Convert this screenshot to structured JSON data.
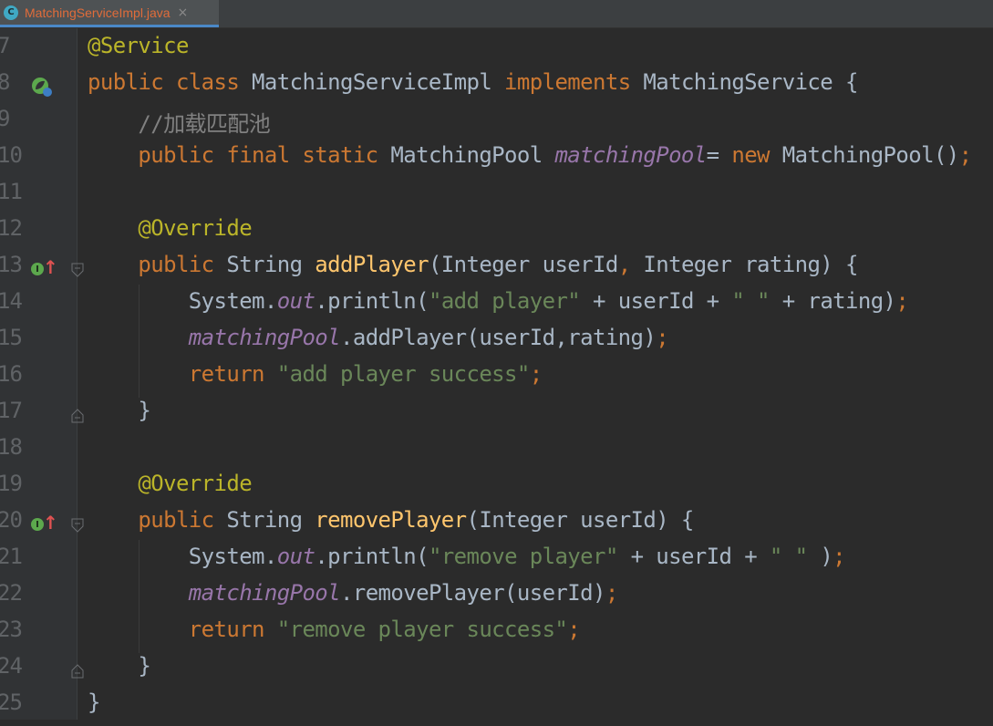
{
  "tab": {
    "icon": "class-c-icon",
    "label": "MatchingServiceImpl.java",
    "close": "×"
  },
  "lines": [
    {
      "num": "7",
      "tokens": [
        {
          "t": "@Service",
          "c": "ann"
        }
      ]
    },
    {
      "num": "8",
      "tokens": [
        {
          "t": "public class ",
          "c": "kw"
        },
        {
          "t": "MatchingServiceImpl ",
          "c": ""
        },
        {
          "t": "implements ",
          "c": "kw"
        },
        {
          "t": "MatchingService {",
          "c": ""
        }
      ]
    },
    {
      "num": "9",
      "tokens": [
        {
          "t": "    //加载匹配池",
          "c": "cmt"
        }
      ]
    },
    {
      "num": "10",
      "tokens": [
        {
          "t": "    public final static ",
          "c": "kw"
        },
        {
          "t": "MatchingPool ",
          "c": ""
        },
        {
          "t": "matchingPool",
          "c": "fld"
        },
        {
          "t": "= ",
          "c": ""
        },
        {
          "t": "new ",
          "c": "kw"
        },
        {
          "t": "MatchingPool()",
          "c": ""
        },
        {
          "t": ";",
          "c": "kw"
        }
      ]
    },
    {
      "num": "11",
      "tokens": []
    },
    {
      "num": "12",
      "tokens": [
        {
          "t": "    @Override",
          "c": "ann"
        }
      ]
    },
    {
      "num": "13",
      "tokens": [
        {
          "t": "    public ",
          "c": "kw"
        },
        {
          "t": "String ",
          "c": ""
        },
        {
          "t": "addPlayer",
          "c": "meth"
        },
        {
          "t": "(Integer userId",
          "c": ""
        },
        {
          "t": ", ",
          "c": "kw"
        },
        {
          "t": "Integer rating) {",
          "c": ""
        }
      ]
    },
    {
      "num": "14",
      "tokens": [
        {
          "t": "        System.",
          "c": ""
        },
        {
          "t": "out",
          "c": "fld"
        },
        {
          "t": ".println(",
          "c": ""
        },
        {
          "t": "\"add player\" ",
          "c": "str"
        },
        {
          "t": "+ userId + ",
          "c": ""
        },
        {
          "t": "\" \" ",
          "c": "str"
        },
        {
          "t": "+ rating)",
          "c": ""
        },
        {
          "t": ";",
          "c": "kw"
        }
      ]
    },
    {
      "num": "15",
      "tokens": [
        {
          "t": "        ",
          "c": ""
        },
        {
          "t": "matchingPool",
          "c": "fld"
        },
        {
          "t": ".addPlayer(userId,rating)",
          "c": ""
        },
        {
          "t": ";",
          "c": "kw"
        }
      ]
    },
    {
      "num": "16",
      "tokens": [
        {
          "t": "        return ",
          "c": "kw"
        },
        {
          "t": "\"add player success\"",
          "c": "str"
        },
        {
          "t": ";",
          "c": "kw"
        }
      ]
    },
    {
      "num": "17",
      "tokens": [
        {
          "t": "    }",
          "c": ""
        }
      ]
    },
    {
      "num": "18",
      "tokens": []
    },
    {
      "num": "19",
      "tokens": [
        {
          "t": "    @Override",
          "c": "ann"
        }
      ]
    },
    {
      "num": "20",
      "tokens": [
        {
          "t": "    public ",
          "c": "kw"
        },
        {
          "t": "String ",
          "c": ""
        },
        {
          "t": "removePlayer",
          "c": "meth"
        },
        {
          "t": "(Integer userId) {",
          "c": ""
        }
      ]
    },
    {
      "num": "21",
      "tokens": [
        {
          "t": "        System.",
          "c": ""
        },
        {
          "t": "out",
          "c": "fld"
        },
        {
          "t": ".println(",
          "c": ""
        },
        {
          "t": "\"remove player\" ",
          "c": "str"
        },
        {
          "t": "+ userId + ",
          "c": ""
        },
        {
          "t": "\" \" ",
          "c": "str"
        },
        {
          "t": ")",
          "c": ""
        },
        {
          "t": ";",
          "c": "kw"
        }
      ]
    },
    {
      "num": "22",
      "tokens": [
        {
          "t": "        ",
          "c": ""
        },
        {
          "t": "matchingPool",
          "c": "fld"
        },
        {
          "t": ".removePlayer(userId)",
          "c": ""
        },
        {
          "t": ";",
          "c": "kw"
        }
      ]
    },
    {
      "num": "23",
      "tokens": [
        {
          "t": "        return ",
          "c": "kw"
        },
        {
          "t": "\"remove player success\"",
          "c": "str"
        },
        {
          "t": ";",
          "c": "kw"
        }
      ]
    },
    {
      "num": "24",
      "tokens": [
        {
          "t": "    }",
          "c": ""
        }
      ]
    },
    {
      "num": "25",
      "tokens": [
        {
          "t": "}",
          "c": ""
        }
      ]
    }
  ],
  "gutter_icons": {
    "bean_line": "8",
    "impl_lines": [
      "13",
      "20"
    ],
    "impl_badge_letter": "I",
    "impl_arrow": "↑"
  },
  "colors": {
    "background": "#2b2b2b",
    "gutter": "#313335",
    "keyword": "#cc7832",
    "annotation": "#bbb529",
    "field": "#9876aa",
    "string": "#6a8759",
    "comment": "#808080",
    "method": "#ffc66d",
    "text": "#a9b7c6",
    "tab_label": "#e06c3a",
    "tab_underline": "#4a88c7"
  }
}
